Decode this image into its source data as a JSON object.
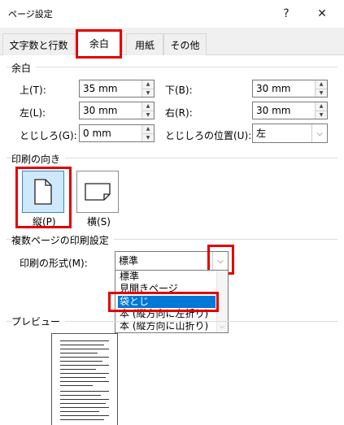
{
  "window": {
    "title": "ページ設定",
    "help_glyph": "?",
    "close_glyph": "✕"
  },
  "tabs": [
    {
      "label": "文字数と行数",
      "active": false
    },
    {
      "label": "余白",
      "active": true
    },
    {
      "label": "用紙",
      "active": false
    },
    {
      "label": "その他",
      "active": false
    }
  ],
  "margins": {
    "section_label": "余白",
    "top_label": "上(T):",
    "top_value": "35 mm",
    "bottom_label": "下(B):",
    "bottom_value": "30 mm",
    "left_label": "左(L):",
    "left_value": "30 mm",
    "right_label": "右(R):",
    "right_value": "30 mm",
    "gutter_label": "とじしろ(G):",
    "gutter_value": "0 mm",
    "gutter_pos_label": "とじしろの位置(U):",
    "gutter_pos_value": "左"
  },
  "orientation": {
    "section_label": "印刷の向き",
    "portrait_label": "縦(P)",
    "landscape_label": "横(S)",
    "selected": "portrait"
  },
  "multiple_pages": {
    "section_label": "複数ページの印刷設定",
    "format_label": "印刷の形式(M):",
    "format_value": "標準",
    "options": [
      "標準",
      "見開きページ",
      "袋とじ",
      "本 (縦方向に左折り)",
      "本 (縦方向に山折り)"
    ],
    "highlighted_option": "袋とじ"
  },
  "preview": {
    "section_label": "プレビュー"
  },
  "colors": {
    "highlight": "#e20000",
    "selection": "#0078d7"
  }
}
